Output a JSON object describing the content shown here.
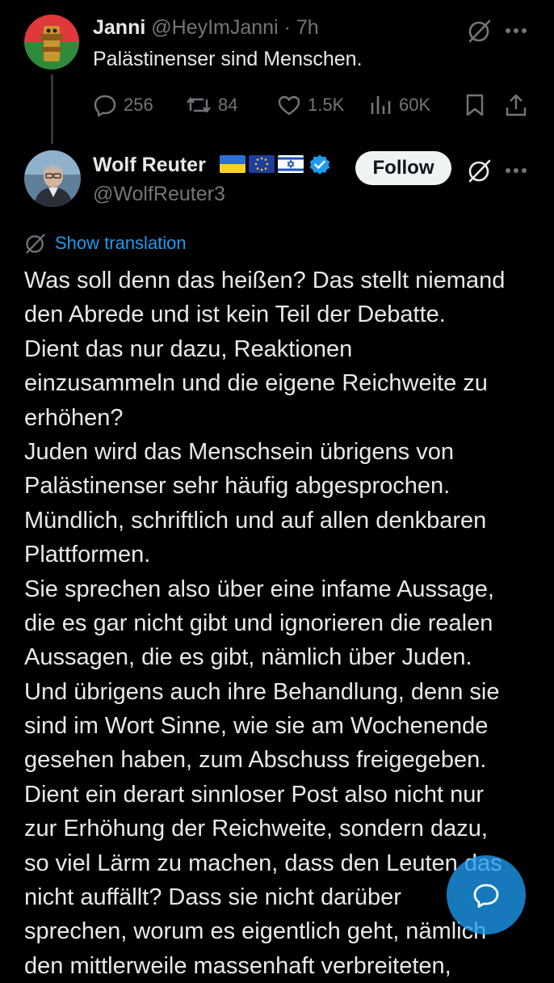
{
  "reply": {
    "author_name": "Janni",
    "author_handle": "@HeyImJanni",
    "separator": "·",
    "time": "7h",
    "text": "Palästinenser sind Menschen.",
    "actions": {
      "replies": "256",
      "reposts": "84",
      "likes": "1.5K",
      "views": "60K"
    },
    "icons": [
      "grok-icon",
      "more-icon",
      "reply-icon",
      "repost-icon",
      "like-icon",
      "views-icon",
      "bookmark-icon",
      "share-icon"
    ]
  },
  "main_post": {
    "author_name": "Wolf Reuter",
    "author_handle": "@WolfReuter3",
    "flags": [
      "ukraine-flag",
      "eu-flag",
      "israel-flag"
    ],
    "verified": true,
    "follow_label": "Follow",
    "show_translation_label": "Show translation",
    "body_lines": [
      "Was soll denn das heißen? Das stellt niemand",
      "den Abrede und ist kein Teil der Debatte.",
      "Dient das nur dazu, Reaktionen",
      "einzusammeln und die eigene Reichweite zu",
      "erhöhen?",
      "Juden wird das Menschsein übrigens von",
      "Palästinenser sehr häufig abgesprochen.",
      "Mündlich, schriftlich und auf allen denkbaren",
      "Plattformen.",
      "Sie sprechen also über eine infame Aussage,",
      "die es gar nicht gibt und ignorieren die realen",
      "Aussagen, die es gibt, nämlich über Juden.",
      "Und übrigens auch ihre Behandlung, denn sie",
      "sind im Wort Sinne, wie sie am Wochenende",
      "gesehen haben, zum Abschuss freigegeben.",
      "Dient ein derart sinnloser Post also nicht nur",
      "zur Erhöhung der Reichweite, sondern dazu,",
      "so viel Lärm zu machen, dass den Leuten das",
      "nicht auffällt? Dass sie nicht darüber",
      "sprechen, worum es eigentlich geht, nämlich",
      "den mittlerweile massenhaft verbreiteten,"
    ]
  },
  "fab": {
    "icon": "compose-reply-icon"
  },
  "colors": {
    "background": "#000000",
    "text": "#e7e9ea",
    "muted": "#71767b",
    "accent": "#1d9bf0",
    "follow_bg": "#eff3f4",
    "thread_line": "#333639"
  }
}
